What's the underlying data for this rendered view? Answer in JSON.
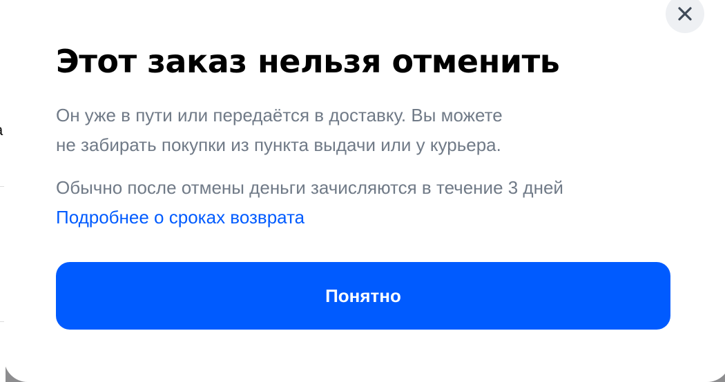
{
  "background": {
    "partial_char": "а"
  },
  "dialog": {
    "title": "Этот заказ нельзя отменить",
    "close_icon": "close-icon",
    "paragraph_1": {
      "line_1": "Он уже в пути или передаётся в доставку. Вы можете",
      "line_2": "не забирать покупки из пункта выдачи или у курьера."
    },
    "paragraph_2": {
      "line_1": "Обычно после отмены деньги зачисляются в течение 3 дней",
      "link": "Подробнее о сроках возврата"
    },
    "confirm_label": "Понятно"
  },
  "colors": {
    "accent": "#005bff",
    "body_text": "#707a87",
    "title_text": "#000000",
    "close_bg": "#eef0f3",
    "overlay": "#8d8d8f"
  }
}
